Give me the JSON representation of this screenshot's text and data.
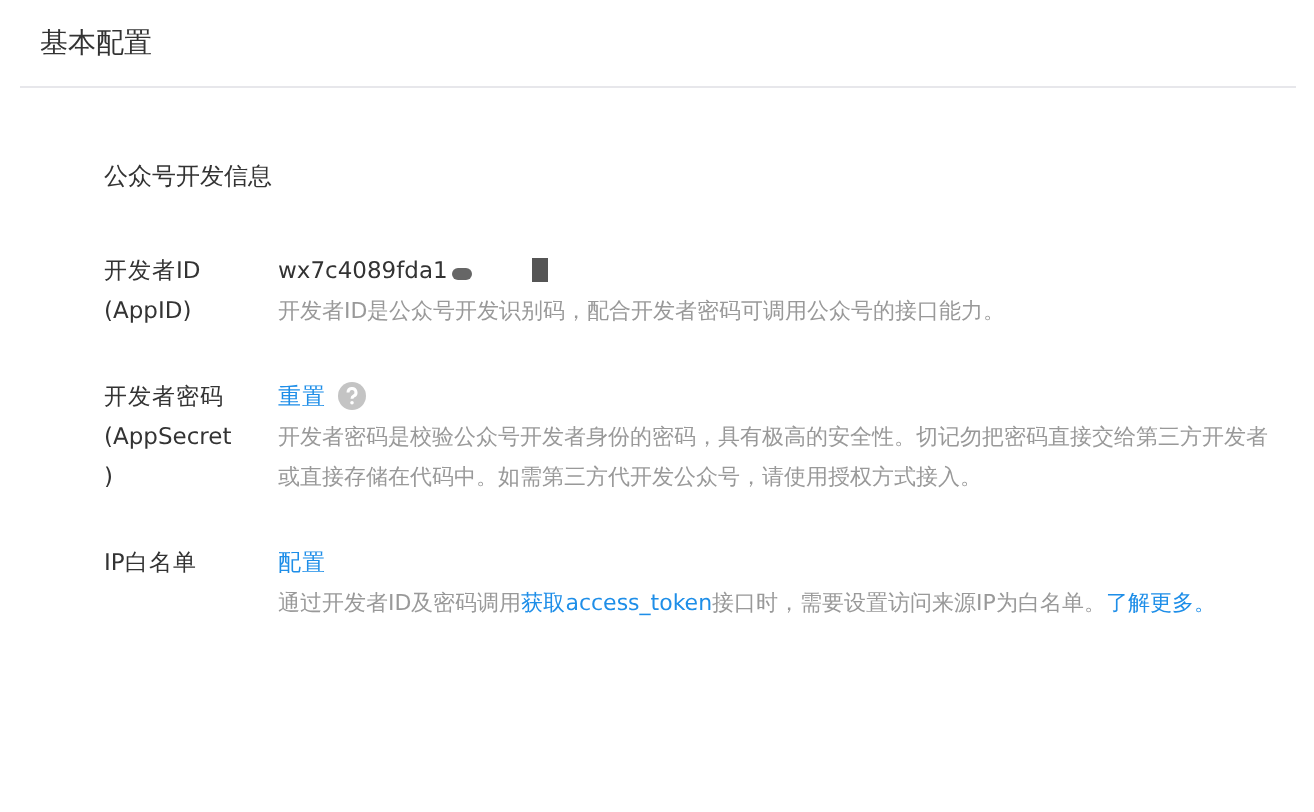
{
  "header": {
    "title": "基本配置"
  },
  "section": {
    "title": "公众号开发信息"
  },
  "rows": [
    {
      "label": [
        "开发者ID",
        "(AppID)"
      ],
      "kind": "value",
      "value": "wx7c4089fda1",
      "redacted": true,
      "help": false,
      "desc": [
        {
          "text": "开发者ID是公众号开发识别码，配合开发者密码可调用公众号的接口能力。",
          "link": false
        }
      ]
    },
    {
      "label": [
        "开发者密码",
        "(AppSecret",
        ")"
      ],
      "kind": "link",
      "value": "重置",
      "redacted": false,
      "help": true,
      "desc": [
        {
          "text": "开发者密码是校验公众号开发者身份的密码，具有极高的安全性。切记勿把密码直接交给第三方开发者或直接存储在代码中。如需第三方代开发公众号，请使用授权方式接入。",
          "link": false
        }
      ]
    },
    {
      "label": [
        "IP白名单"
      ],
      "kind": "link",
      "value": "配置",
      "redacted": false,
      "help": false,
      "desc": [
        {
          "text": "通过开发者ID及密码调用",
          "link": false
        },
        {
          "text": "获取access_token",
          "link": true
        },
        {
          "text": "接口时，需要设置访问来源IP为白名单。",
          "link": false
        },
        {
          "text": "了解更多。",
          "link": true
        }
      ]
    }
  ]
}
